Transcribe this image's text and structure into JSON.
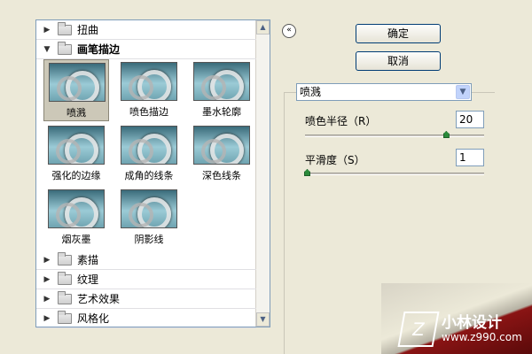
{
  "tree": {
    "categories": [
      {
        "label": "扭曲",
        "open": false
      },
      {
        "label": "画笔描边",
        "open": true
      },
      {
        "label": "素描",
        "open": false
      },
      {
        "label": "纹理",
        "open": false
      },
      {
        "label": "艺术效果",
        "open": false
      },
      {
        "label": "风格化",
        "open": false
      }
    ],
    "thumbnails": [
      {
        "label": "喷溅",
        "selected": true
      },
      {
        "label": "喷色描边",
        "selected": false
      },
      {
        "label": "墨水轮廓",
        "selected": false
      },
      {
        "label": "强化的边缘",
        "selected": false
      },
      {
        "label": "成角的线条",
        "selected": false
      },
      {
        "label": "深色线条",
        "selected": false
      },
      {
        "label": "烟灰墨",
        "selected": false
      },
      {
        "label": "阴影线",
        "selected": false
      }
    ]
  },
  "buttons": {
    "ok": "确定",
    "cancel": "取消",
    "collapse_glyph": "«"
  },
  "filter": {
    "selected": "喷溅"
  },
  "params": {
    "spray_radius_label": "喷色半径（R）",
    "spray_radius_value": "20",
    "spray_radius_level": 0.8,
    "smoothness_label": "平滑度（S）",
    "smoothness_value": "1",
    "smoothness_level": 0.0
  },
  "watermark": {
    "name": "小林设计",
    "url": "www.z990.com",
    "mark": "Z"
  },
  "colors": {
    "accent_border": "#003c74",
    "panel_bg": "#ece9d8",
    "curl_red": "#8a1414"
  }
}
